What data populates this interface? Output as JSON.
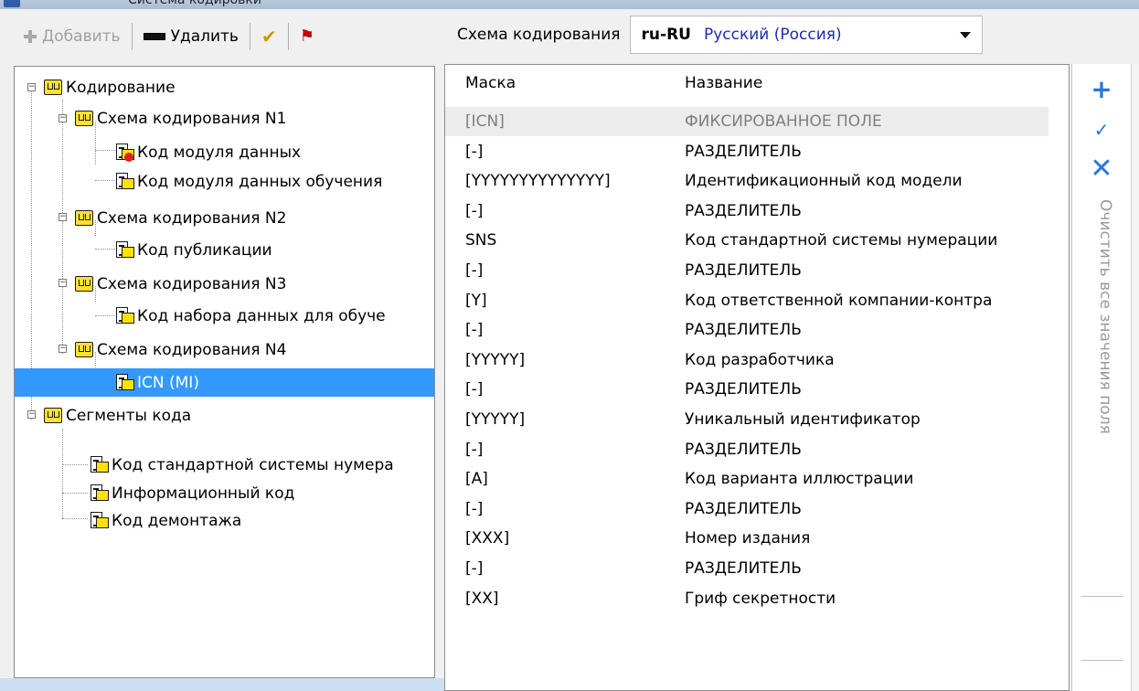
{
  "window": {
    "title": "Система кодировки"
  },
  "toolbar": {
    "add_label": "Добавить",
    "delete_label": "Удалить",
    "check_icon": "checkmark-icon",
    "flag_icon": "flag-icon"
  },
  "tree": {
    "root": "Кодирование",
    "schemes": [
      {
        "label": "Схема кодирования N1",
        "children": [
          "Код модуля данных",
          "Код модуля данных обучения"
        ]
      },
      {
        "label": "Схема кодирования N2",
        "children": [
          "Код публикации"
        ]
      },
      {
        "label": "Схема кодирования N3",
        "children": [
          "Код набора данных для обуче"
        ]
      },
      {
        "label": "Схема кодирования N4",
        "children": [
          "ICN (MI)"
        ]
      }
    ],
    "segments_root": "Сегменты кода",
    "segments": [
      "Код стандартной системы нумера",
      "Информационный код",
      "Код демонтажа"
    ],
    "selected": "ICN (MI)"
  },
  "scheme": {
    "label": "Схема кодирования",
    "code": "ru-RU",
    "language": "Русский (Россия)"
  },
  "grid": {
    "columns": {
      "mask": "Маска",
      "name": "Название"
    },
    "rows": [
      {
        "mask": "[ICN]",
        "name": "ФИКСИРОВАННОЕ ПОЛЕ"
      },
      {
        "mask": "[-]",
        "name": "РАЗДЕЛИТЕЛЬ"
      },
      {
        "mask": "[YYYYYYYYYYYYYY]",
        "name": "Идентификационный код модели"
      },
      {
        "mask": "[-]",
        "name": "РАЗДЕЛИТЕЛЬ"
      },
      {
        "mask": "SNS",
        "name": "Код стандартной системы нумерации"
      },
      {
        "mask": "[-]",
        "name": "РАЗДЕЛИТЕЛЬ"
      },
      {
        "mask": "[Y]",
        "name": "Код ответственной компании-контра"
      },
      {
        "mask": "[-]",
        "name": "РАЗДЕЛИТЕЛЬ"
      },
      {
        "mask": "[YYYYY]",
        "name": "Код разработчика"
      },
      {
        "mask": "[-]",
        "name": "РАЗДЕЛИТЕЛЬ"
      },
      {
        "mask": "[YYYYY]",
        "name": "Уникальный идентификатор"
      },
      {
        "mask": "[-]",
        "name": "РАЗДЕЛИТЕЛЬ"
      },
      {
        "mask": "[A]",
        "name": "Код варианта иллюстрации"
      },
      {
        "mask": "[-]",
        "name": "РАЗДЕЛИТЕЛЬ"
      },
      {
        "mask": "[XXX]",
        "name": "Номер издания"
      },
      {
        "mask": "[-]",
        "name": "РАЗДЕЛИТЕЛЬ"
      },
      {
        "mask": "[XX]",
        "name": "Гриф секретности"
      }
    ]
  },
  "side": {
    "add_icon": "plus-icon",
    "apply_icon": "check-icon",
    "cancel_icon": "close-icon",
    "clear_label": "Очистить все значения поля"
  }
}
